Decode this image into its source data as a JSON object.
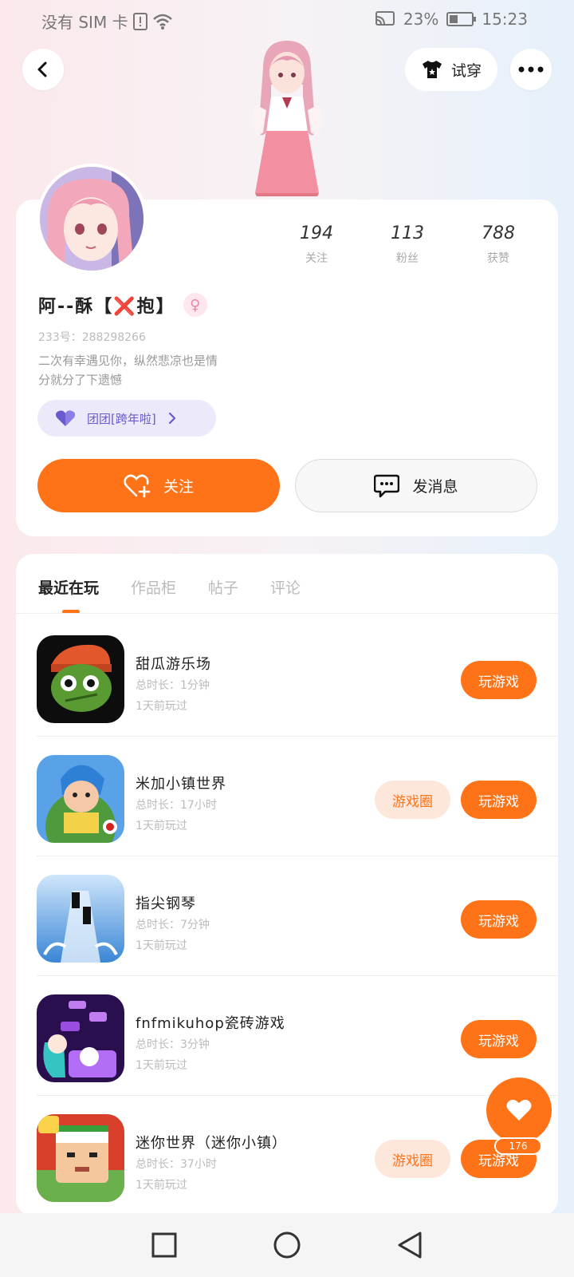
{
  "status_bar": {
    "carrier": "没有 SIM 卡",
    "battery_pct": "23%",
    "time": "15:23"
  },
  "header": {
    "tryon_label": "试穿"
  },
  "colors": {
    "accent": "#ff7318",
    "accent_light": "#fde7da",
    "purple": "#6a5ad0"
  },
  "profile": {
    "name": "阿--酥【❌抱】",
    "uid": "233号：288298266",
    "bio_line1": "二次有幸遇见你，纵然悲凉也是情",
    "bio_line2": "分就分了下遗憾",
    "group_label": "团团[跨年啦]",
    "stats": [
      {
        "num": "194",
        "label": "关注"
      },
      {
        "num": "113",
        "label": "粉丝"
      },
      {
        "num": "788",
        "label": "获赞"
      }
    ],
    "follow_label": "关注",
    "message_label": "发消息"
  },
  "tabs": [
    {
      "label": "最近在玩"
    },
    {
      "label": "作品柜"
    },
    {
      "label": "帖子"
    },
    {
      "label": "评论"
    }
  ],
  "games": [
    {
      "title": "甜瓜游乐场",
      "duration": "总时长：1分钟",
      "last": "1天前玩过",
      "play_label": "玩游戏",
      "circle_label": ""
    },
    {
      "title": "米加小镇世界",
      "duration": "总时长：17小时",
      "last": "1天前玩过",
      "play_label": "玩游戏",
      "circle_label": "游戏圈"
    },
    {
      "title": "指尖钢琴",
      "duration": "总时长：7分钟",
      "last": "1天前玩过",
      "play_label": "玩游戏",
      "circle_label": ""
    },
    {
      "title": "fnfmikuhop瓷砖游戏",
      "duration": "总时长：3分钟",
      "last": "1天前玩过",
      "play_label": "玩游戏",
      "circle_label": ""
    },
    {
      "title": "迷你世界（迷你小镇）",
      "duration": "总时长：37小时",
      "last": "1天前玩过",
      "play_label": "玩游戏",
      "circle_label": "游戏圈"
    }
  ],
  "floating": {
    "count": "176"
  }
}
